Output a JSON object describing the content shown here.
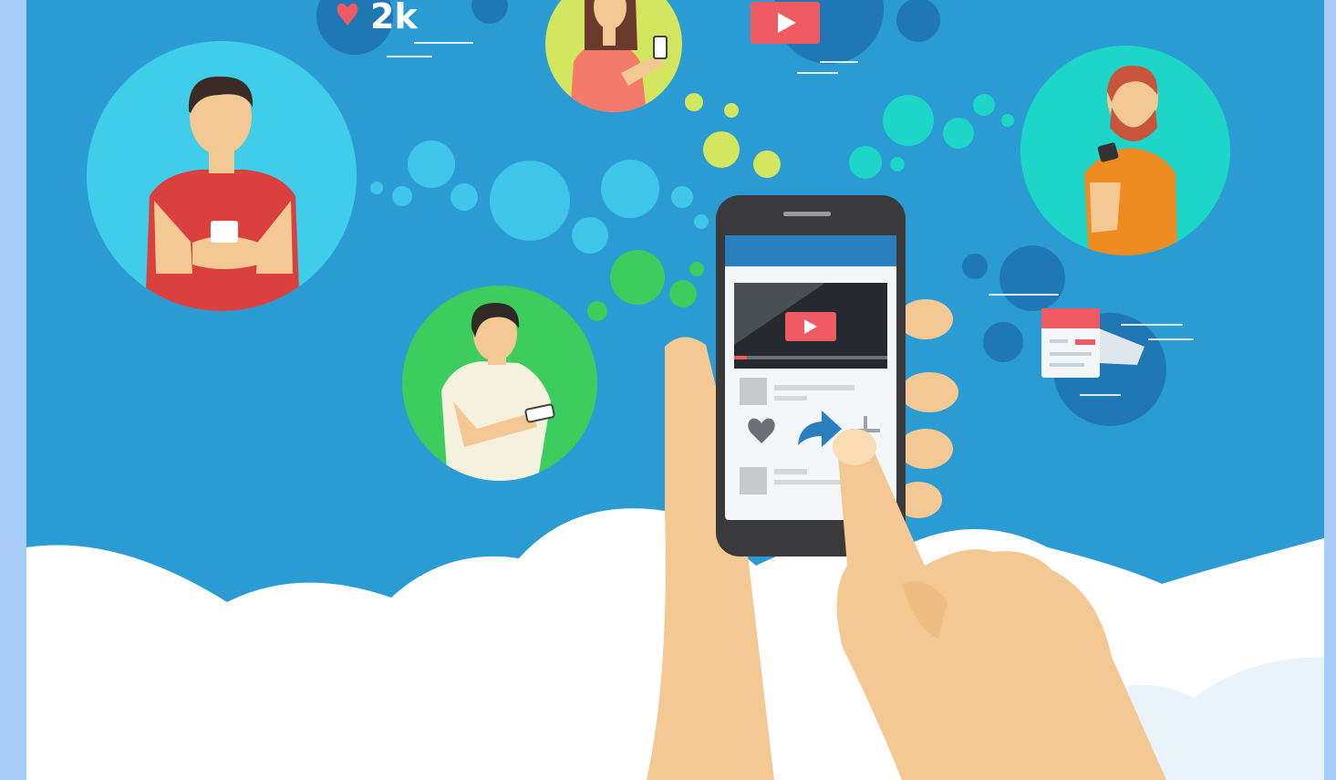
{
  "illustration": {
    "likes_count": "2k",
    "colors": {
      "sky": "#2a9bd3",
      "cloud": "#ffffff",
      "skin": "#f4c892",
      "accent_red": "#ef5b62",
      "share_blue": "#2a7fbf",
      "page_margin": "#a9cdf8"
    },
    "icons": [
      "heart-icon",
      "play-icon",
      "share-arrow-icon",
      "plus-icon",
      "article-card-icon"
    ]
  }
}
